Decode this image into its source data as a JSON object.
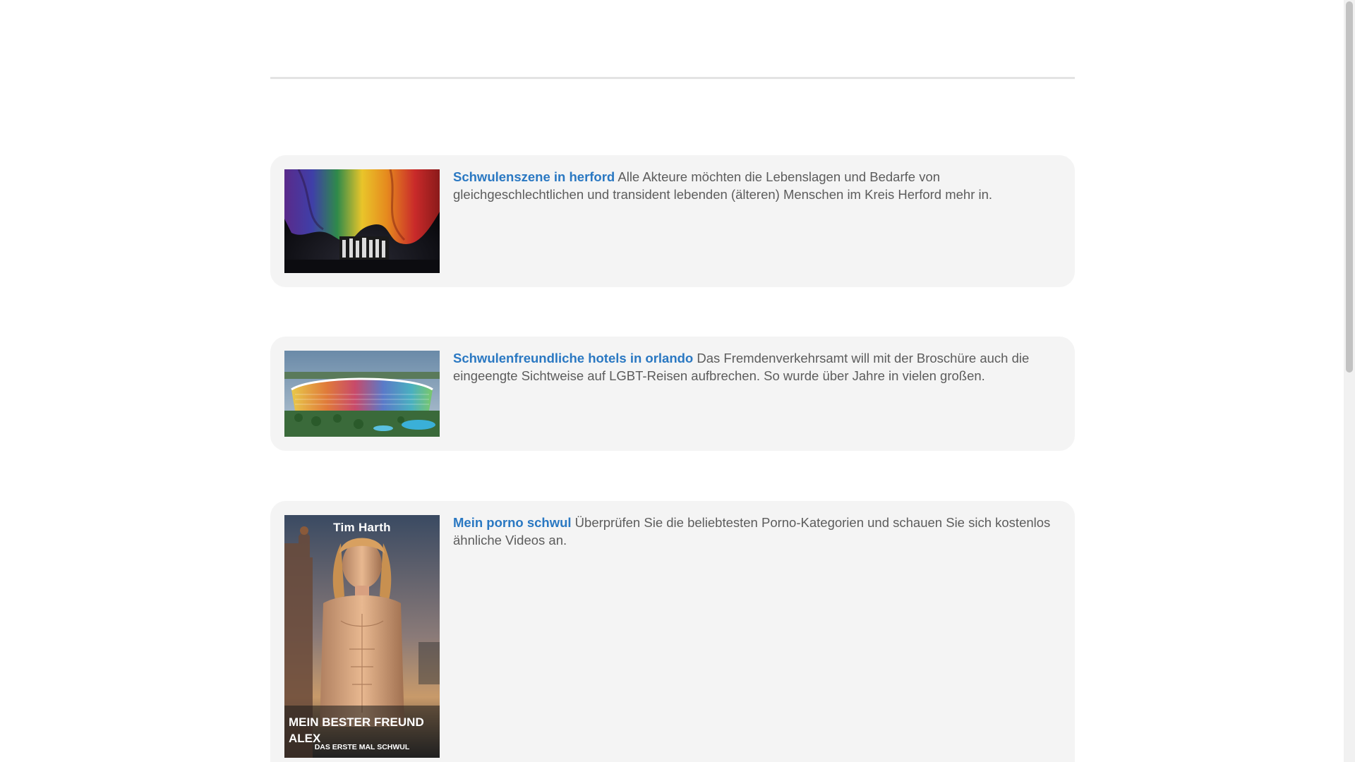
{
  "articles": [
    {
      "title": "Schwulenszene in herford",
      "text": "Alle Akteure möchten die Lebenslagen und Bedarfe von gleichgeschlechtlichen und transident lebenden (älteren) Menschen im Kreis Herford mehr in.",
      "image": "rainbow-flag-stage-photo"
    },
    {
      "title": "Schwulenfreundliche hotels in orlando",
      "text": "Das Fremdenverkehrsamt will mit der Broschüre auch die eingeengte Sichtweise auf LGBT-Reisen aufbrechen. So wurde über Jahre in vielen großen.",
      "image": "colorful-hotel-aerial-photo"
    },
    {
      "title": "Mein porno schwul",
      "text": "Überprüfen Sie die beliebtesten Porno-Kategorien und schauen Sie sich kostenlos ähnliche Videos an.",
      "image": "book-cover",
      "cover": {
        "author": "Tim Harth",
        "title_line1": "MEIN BESTER FREUND",
        "title_line2": "ALEX",
        "subtitle": "DAS ERSTE MAL SCHWUL"
      }
    }
  ],
  "colors": {
    "link": "#2a78c2",
    "body_text": "#5c5c5c",
    "card_bg": "#f4f4f4",
    "rule": "#e3e3e3"
  }
}
